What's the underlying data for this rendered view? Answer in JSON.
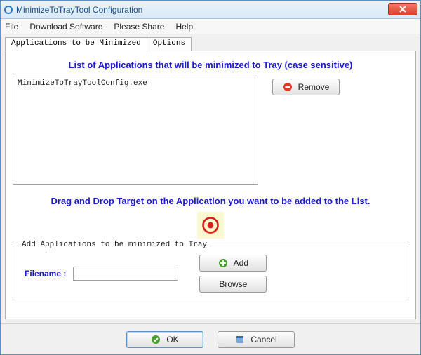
{
  "window": {
    "title": "MinimizeToTrayTool Configuration"
  },
  "menubar": {
    "file": "File",
    "download": "Download Software",
    "share": "Please Share",
    "help": "Help"
  },
  "tabs": {
    "apps": "Applications to be Minimized",
    "options": "Options"
  },
  "main": {
    "list_heading": "List of Applications that will be minimized to Tray (case sensitive)",
    "listbox_items": [
      "MinimizeToTrayToolConfig.exe"
    ],
    "remove_label": "Remove",
    "drag_heading": "Drag and Drop Target on the Application you want to be added to the List.",
    "fieldset_legend": "Add Applications to be minimized to Tray",
    "filename_label": "Filename :",
    "filename_value": "",
    "add_label": "Add",
    "browse_label": "Browse"
  },
  "footer": {
    "ok": "OK",
    "cancel": "Cancel"
  }
}
